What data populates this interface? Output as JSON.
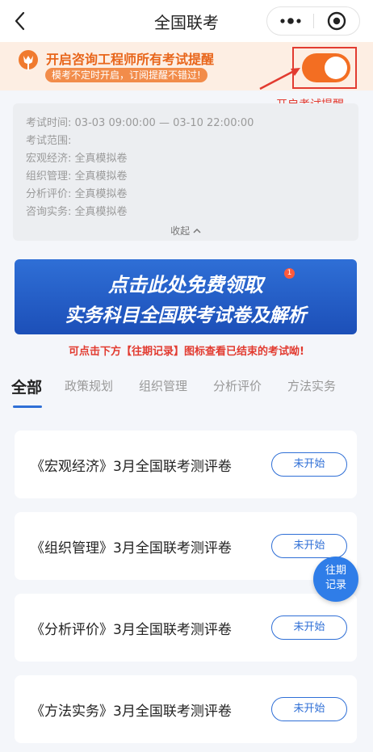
{
  "navbar": {
    "title": "全国联考"
  },
  "notice": {
    "title": "开启咨询工程师所有考试提醒",
    "subtitle": "模考不定时开启，订阅提醒不错过!",
    "toggle_on": true,
    "annotation": "开启考试提醒"
  },
  "info": {
    "rows": [
      {
        "label": "考试时间:",
        "value": "03-03 09:00:00 — 03-10 22:00:00"
      },
      {
        "label": "考试范围:",
        "value": ""
      },
      {
        "label": "宏观经济:",
        "value": "全真模拟卷"
      },
      {
        "label": "组织管理:",
        "value": "全真模拟卷"
      },
      {
        "label": "分析评价:",
        "value": "全真模拟卷"
      },
      {
        "label": "咨询实务:",
        "value": "全真模拟卷"
      }
    ],
    "collapse": "收起"
  },
  "banner": {
    "line1": "点击此处免费领取",
    "line2": "实务科目全国联考试卷及解析",
    "badge": "1"
  },
  "hint": "可点击下方【往期记录】图标查看已结束的考试呦!",
  "tabs": [
    "全部",
    "政策规划",
    "组织管理",
    "分析评价",
    "方法实务"
  ],
  "exams": [
    {
      "title": "《宏观经济》3月全国联考测评卷",
      "status": "未开始"
    },
    {
      "title": "《组织管理》3月全国联考测评卷",
      "status": "未开始"
    },
    {
      "title": "《分析评价》3月全国联考测评卷",
      "status": "未开始"
    },
    {
      "title": "《方法实务》3月全国联考测评卷",
      "status": "未开始"
    }
  ],
  "fab": {
    "line1": "往期",
    "line2": "记录"
  },
  "colors": {
    "accent": "#2f6fd6",
    "orange": "#f36e22",
    "red": "#e23b30"
  }
}
